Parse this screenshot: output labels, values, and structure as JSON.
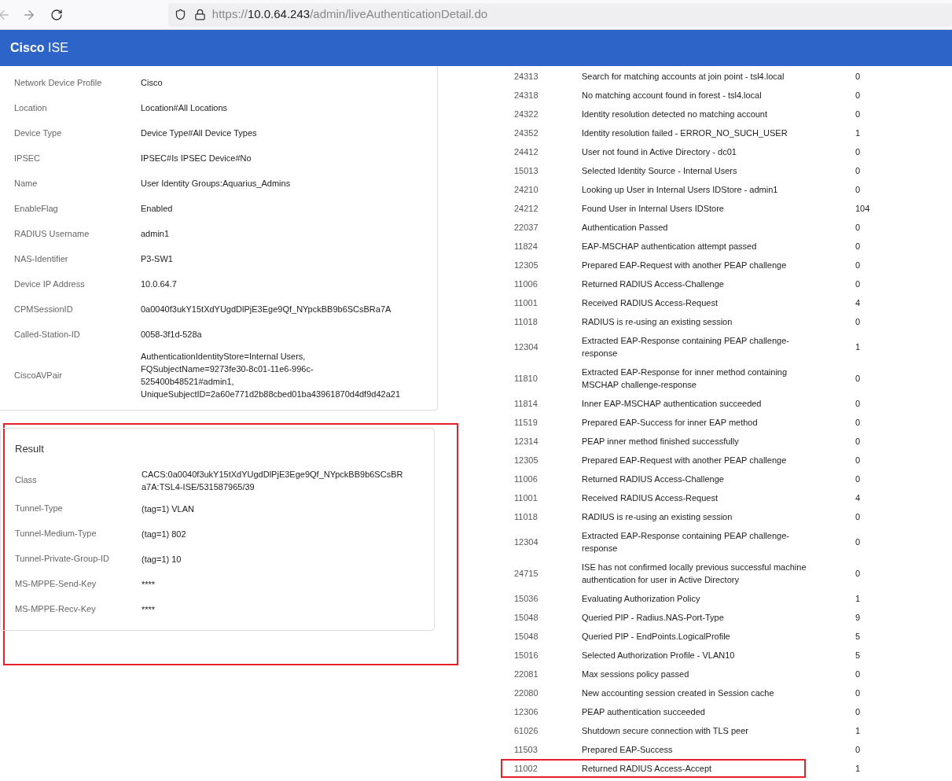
{
  "browser": {
    "url": {
      "scheme": "https://",
      "host": "10.0.64.243",
      "path": "/admin/liveAuthenticationDetail.do"
    }
  },
  "header": {
    "brand": "Cisco",
    "product": "ISE"
  },
  "details": [
    {
      "label": "Network Device Profile",
      "value": "Cisco"
    },
    {
      "label": "Location",
      "value": "Location#All Locations"
    },
    {
      "label": "Device Type",
      "value": "Device Type#All Device Types"
    },
    {
      "label": "IPSEC",
      "value": "IPSEC#Is IPSEC Device#No"
    },
    {
      "label": "Name",
      "value": "User Identity Groups:Aquarius_Admins"
    },
    {
      "label": "EnableFlag",
      "value": "Enabled"
    },
    {
      "label": "RADIUS Username",
      "value": "admin1"
    },
    {
      "label": "NAS-Identifier",
      "value": "P3-SW1"
    },
    {
      "label": "Device IP Address",
      "value": "10.0.64.7"
    },
    {
      "label": "CPMSessionID",
      "value": "0a0040f3ukY15tXdYUgdDlPjE3Ege9Qf_NYpckBB9b6SCsBRa7A"
    },
    {
      "label": "Called-Station-ID",
      "value": "0058-3f1d-528a"
    },
    {
      "label": "CiscoAVPair",
      "value": "AuthenticationIdentityStore=Internal Users, FQSubjectName=9273fe30-8c01-11e6-996c-525400b48521#admin1, UniqueSubjectID=2a60e771d2b88cbed01ba43961870d4df9d42a21"
    }
  ],
  "result": {
    "title": "Result",
    "highlighted": true,
    "rows": [
      {
        "label": "Class",
        "value": "CACS:0a0040f3ukY15tXdYUgdDlPjE3Ege9Qf_NYpckBB9b6SCsBRa7A:TSL4-ISE/531587965/39"
      },
      {
        "label": "Tunnel-Type",
        "value": "(tag=1) VLAN"
      },
      {
        "label": "Tunnel-Medium-Type",
        "value": "(tag=1) 802"
      },
      {
        "label": "Tunnel-Private-Group-ID",
        "value": "(tag=1) 10"
      },
      {
        "label": "MS-MPPE-Send-Key",
        "value": "****"
      },
      {
        "label": "MS-MPPE-Recv-Key",
        "value": "****"
      }
    ]
  },
  "steps": [
    {
      "code": "24313",
      "description": "Search for matching accounts at join point - tsl4.local",
      "latency": "0",
      "highlighted": false
    },
    {
      "code": "24318",
      "description": "No matching account found in forest - tsl4.local",
      "latency": "0",
      "highlighted": false
    },
    {
      "code": "24322",
      "description": "Identity resolution detected no matching account",
      "latency": "0",
      "highlighted": false
    },
    {
      "code": "24352",
      "description": "Identity resolution failed - ERROR_NO_SUCH_USER",
      "latency": "1",
      "highlighted": false
    },
    {
      "code": "24412",
      "description": "User not found in Active Directory - dc01",
      "latency": "0",
      "highlighted": false
    },
    {
      "code": "15013",
      "description": "Selected Identity Source - Internal Users",
      "latency": "0",
      "highlighted": false
    },
    {
      "code": "24210",
      "description": "Looking up User in Internal Users IDStore - admin1",
      "latency": "0",
      "highlighted": false
    },
    {
      "code": "24212",
      "description": "Found User in Internal Users IDStore",
      "latency": "104",
      "highlighted": false
    },
    {
      "code": "22037",
      "description": "Authentication Passed",
      "latency": "0",
      "highlighted": false
    },
    {
      "code": "11824",
      "description": "EAP-MSCHAP authentication attempt passed",
      "latency": "0",
      "highlighted": false
    },
    {
      "code": "12305",
      "description": "Prepared EAP-Request with another PEAP challenge",
      "latency": "0",
      "highlighted": false
    },
    {
      "code": "11006",
      "description": "Returned RADIUS Access-Challenge",
      "latency": "0",
      "highlighted": false
    },
    {
      "code": "11001",
      "description": "Received RADIUS Access-Request",
      "latency": "4",
      "highlighted": false
    },
    {
      "code": "11018",
      "description": "RADIUS is re-using an existing session",
      "latency": "0",
      "highlighted": false
    },
    {
      "code": "12304",
      "description": "Extracted EAP-Response containing PEAP challenge-response",
      "latency": "1",
      "highlighted": false
    },
    {
      "code": "11810",
      "description": "Extracted EAP-Response for inner method containing MSCHAP challenge-response",
      "latency": "0",
      "highlighted": false
    },
    {
      "code": "11814",
      "description": "Inner EAP-MSCHAP authentication succeeded",
      "latency": "0",
      "highlighted": false
    },
    {
      "code": "11519",
      "description": "Prepared EAP-Success for inner EAP method",
      "latency": "0",
      "highlighted": false
    },
    {
      "code": "12314",
      "description": "PEAP inner method finished successfully",
      "latency": "0",
      "highlighted": false
    },
    {
      "code": "12305",
      "description": "Prepared EAP-Request with another PEAP challenge",
      "latency": "0",
      "highlighted": false
    },
    {
      "code": "11006",
      "description": "Returned RADIUS Access-Challenge",
      "latency": "0",
      "highlighted": false
    },
    {
      "code": "11001",
      "description": "Received RADIUS Access-Request",
      "latency": "4",
      "highlighted": false
    },
    {
      "code": "11018",
      "description": "RADIUS is re-using an existing session",
      "latency": "0",
      "highlighted": false
    },
    {
      "code": "12304",
      "description": "Extracted EAP-Response containing PEAP challenge-response",
      "latency": "0",
      "highlighted": false
    },
    {
      "code": "24715",
      "description": "ISE has not confirmed locally previous successful machine authentication for user in Active Directory",
      "latency": "0",
      "highlighted": false
    },
    {
      "code": "15036",
      "description": "Evaluating Authorization Policy",
      "latency": "1",
      "highlighted": false
    },
    {
      "code": "15048",
      "description": "Queried PIP - Radius.NAS-Port-Type",
      "latency": "9",
      "highlighted": false
    },
    {
      "code": "15048",
      "description": "Queried PIP - EndPoints.LogicalProfile",
      "latency": "5",
      "highlighted": false
    },
    {
      "code": "15016",
      "description": "Selected Authorization Profile - VLAN10",
      "latency": "5",
      "highlighted": false
    },
    {
      "code": "22081",
      "description": "Max sessions policy passed",
      "latency": "0",
      "highlighted": false
    },
    {
      "code": "22080",
      "description": "New accounting session created in Session cache",
      "latency": "0",
      "highlighted": false
    },
    {
      "code": "12306",
      "description": "PEAP authentication succeeded",
      "latency": "0",
      "highlighted": false
    },
    {
      "code": "61026",
      "description": "Shutdown secure connection with TLS peer",
      "latency": "1",
      "highlighted": false
    },
    {
      "code": "11503",
      "description": "Prepared EAP-Success",
      "latency": "0",
      "highlighted": false
    },
    {
      "code": "11002",
      "description": "Returned RADIUS Access-Accept",
      "latency": "1",
      "highlighted": true
    }
  ]
}
